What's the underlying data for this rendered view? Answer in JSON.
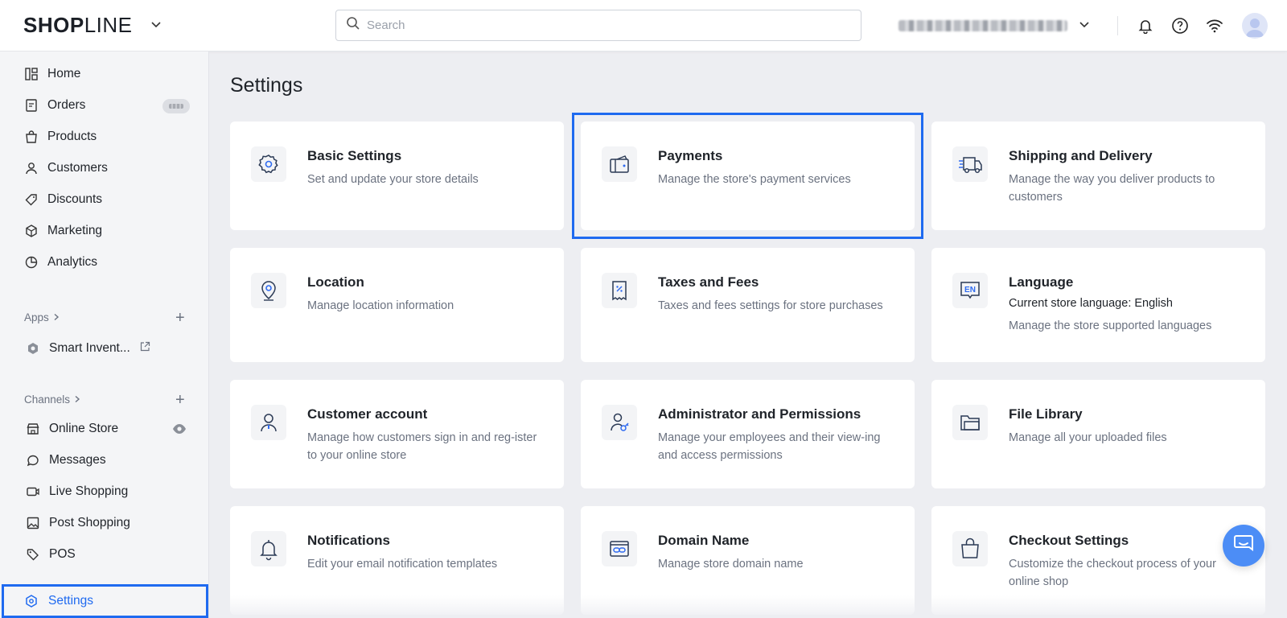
{
  "brand": {
    "logo_bold": "SHOP",
    "logo_light": "LINE"
  },
  "header": {
    "search_placeholder": "Search",
    "icons": [
      "chevron-down-icon",
      "bell-icon",
      "help-icon",
      "wifi-icon",
      "avatar"
    ]
  },
  "sidebar": {
    "items": [
      {
        "label": "Home",
        "icon": "dashboard-icon"
      },
      {
        "label": "Orders",
        "icon": "orders-icon"
      },
      {
        "label": "Products",
        "icon": "bag-icon"
      },
      {
        "label": "Customers",
        "icon": "person-icon"
      },
      {
        "label": "Discounts",
        "icon": "tag-icon"
      },
      {
        "label": "Marketing",
        "icon": "cube-icon"
      },
      {
        "label": "Analytics",
        "icon": "pie-icon"
      }
    ],
    "apps_label": "Apps",
    "apps": [
      {
        "label": "Smart Invent...",
        "icon": "hexagon-icon"
      }
    ],
    "channels_label": "Channels",
    "channels": [
      {
        "label": "Online Store",
        "icon": "store-icon"
      },
      {
        "label": "Messages",
        "icon": "chat-icon"
      },
      {
        "label": "Live Shopping",
        "icon": "video-icon"
      },
      {
        "label": "Post Shopping",
        "icon": "image-icon"
      },
      {
        "label": "POS",
        "icon": "pos-tag-icon"
      }
    ],
    "settings_label": "Settings"
  },
  "main": {
    "title": "Settings",
    "cards": [
      {
        "title": "Basic Settings",
        "desc": "Set and update your store details"
      },
      {
        "title": "Payments",
        "desc": "Manage the store's payment services"
      },
      {
        "title": "Shipping and Delivery",
        "desc": "Manage the way you deliver products to customers"
      },
      {
        "title": "Location",
        "desc": "Manage location information"
      },
      {
        "title": "Taxes and Fees",
        "desc": "Taxes and fees settings for store purchases"
      },
      {
        "title": "Language",
        "desc_strong": "Current store language: English",
        "desc": "Manage the store supported languages"
      },
      {
        "title": "Customer account",
        "desc": "Manage how customers sign in and reg-ister to your online store"
      },
      {
        "title": "Administrator and Permissions",
        "desc": "Manage your employees and their view-ing and access permissions"
      },
      {
        "title": "File Library",
        "desc": "Manage all your uploaded files"
      },
      {
        "title": "Notifications",
        "desc": "Edit your email notification templates"
      },
      {
        "title": "Domain Name",
        "desc": "Manage store domain name"
      },
      {
        "title": "Checkout Settings",
        "desc": "Customize the checkout process of your online shop"
      }
    ],
    "en_icon_text": "EN"
  },
  "colors": {
    "accent": "#1f6af0",
    "chat": "#4c8df6"
  }
}
